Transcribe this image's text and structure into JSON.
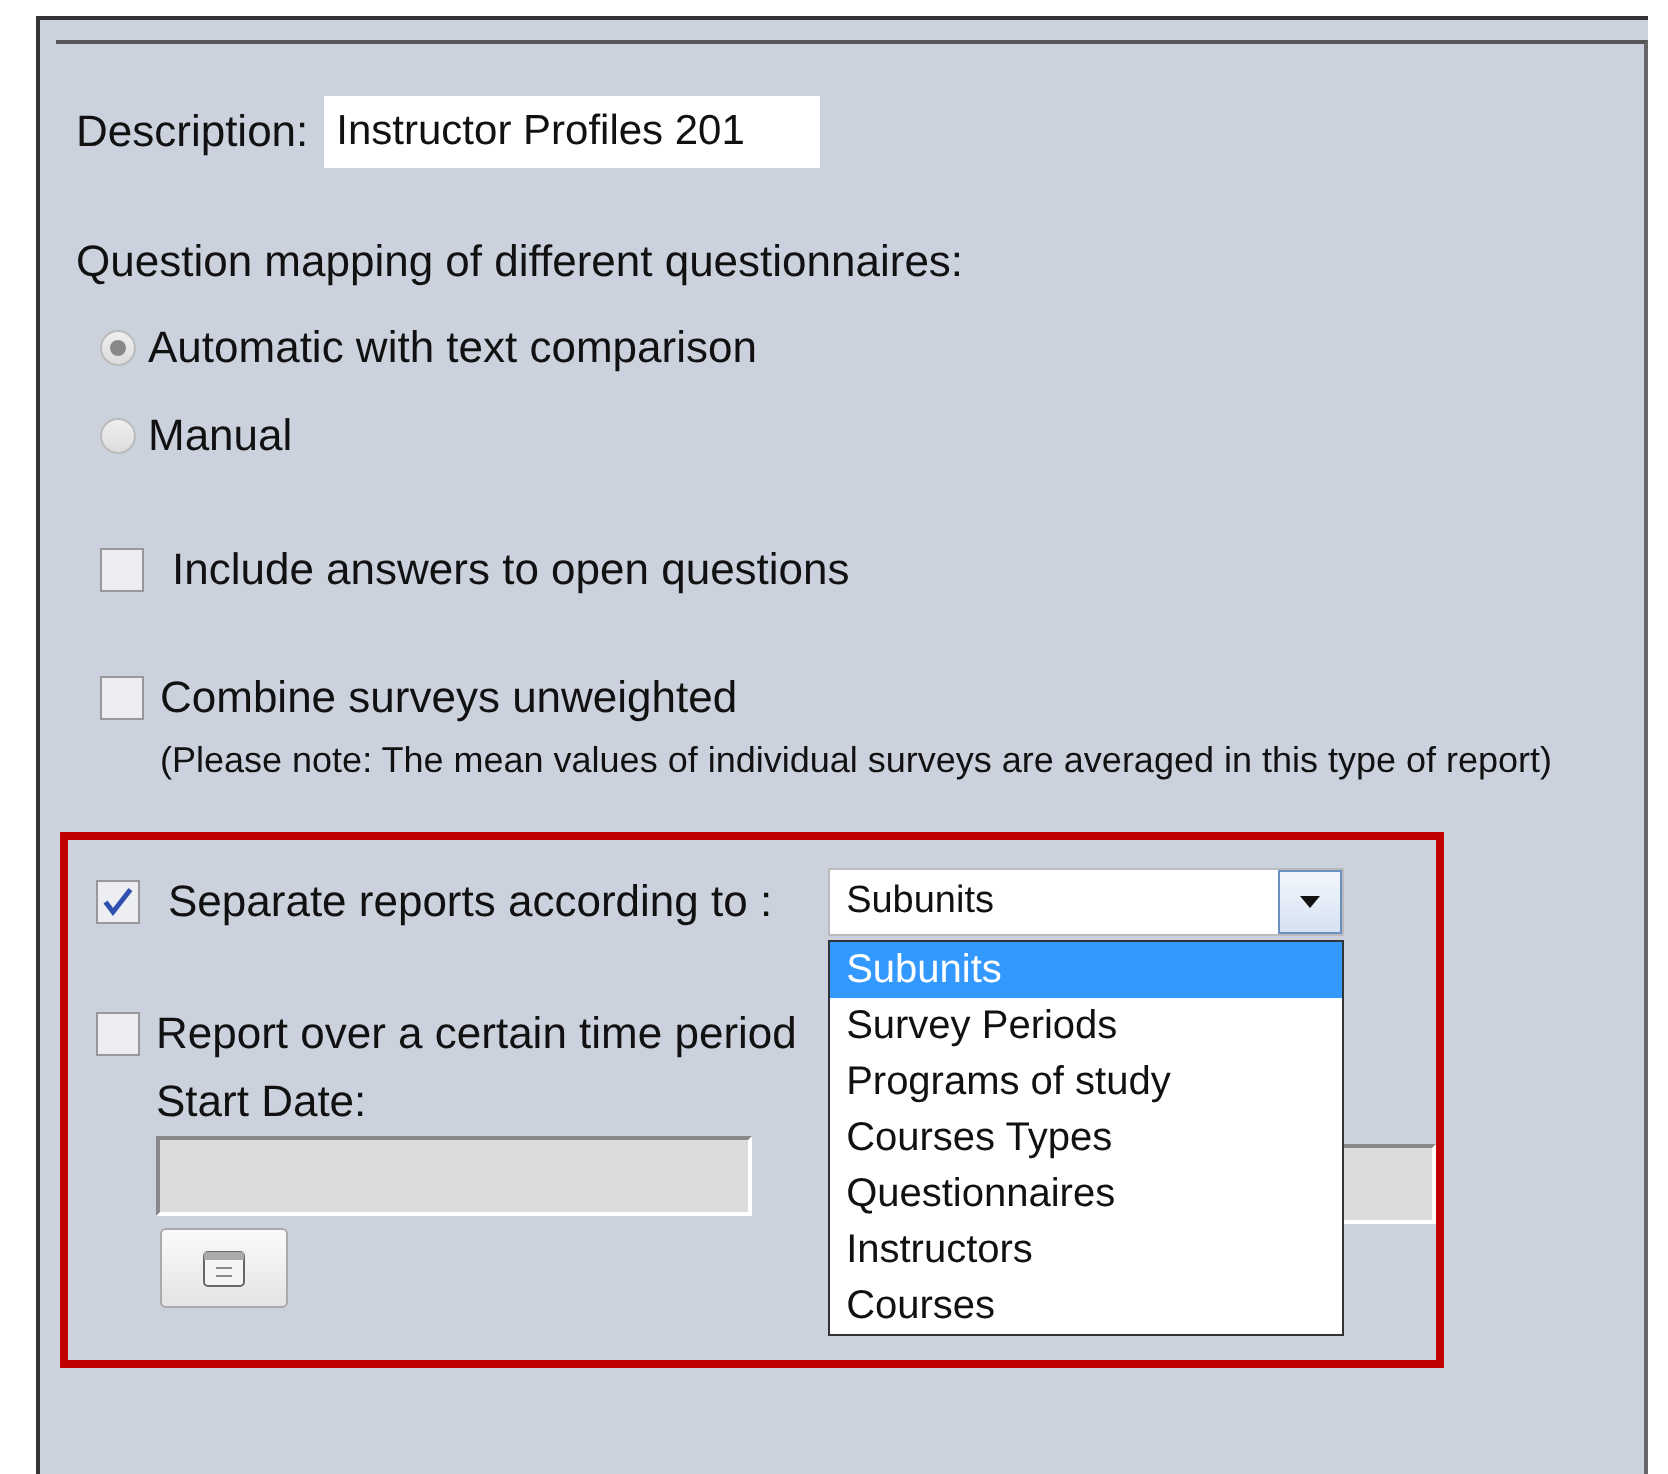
{
  "description": {
    "label": "Description:",
    "value": "Instructor Profiles 201"
  },
  "mapping": {
    "label": "Question mapping of different questionnaires:",
    "options": [
      {
        "label": "Automatic with text comparison",
        "selected": true
      },
      {
        "label": "Manual",
        "selected": false
      }
    ]
  },
  "include_open": {
    "label": "Include answers to open questions",
    "checked": false
  },
  "combine": {
    "label": "Combine surveys unweighted",
    "note": "(Please note: The mean values of individual surveys are averaged in this type of report)",
    "checked": false
  },
  "separate": {
    "label": "Separate reports according to :",
    "checked": true,
    "value": "Subunits",
    "options": [
      {
        "label": "Subunits",
        "selected": true
      },
      {
        "label": "Survey Periods",
        "selected": false
      },
      {
        "label": "Programs of study",
        "selected": false
      },
      {
        "label": "Courses Types",
        "selected": false
      },
      {
        "label": "Questionnaires",
        "selected": false
      },
      {
        "label": "Instructors",
        "selected": false
      },
      {
        "label": "Courses",
        "selected": false
      }
    ]
  },
  "time_period": {
    "label": "Report over a certain time period",
    "checked": false,
    "start_label": "Start Date:"
  }
}
